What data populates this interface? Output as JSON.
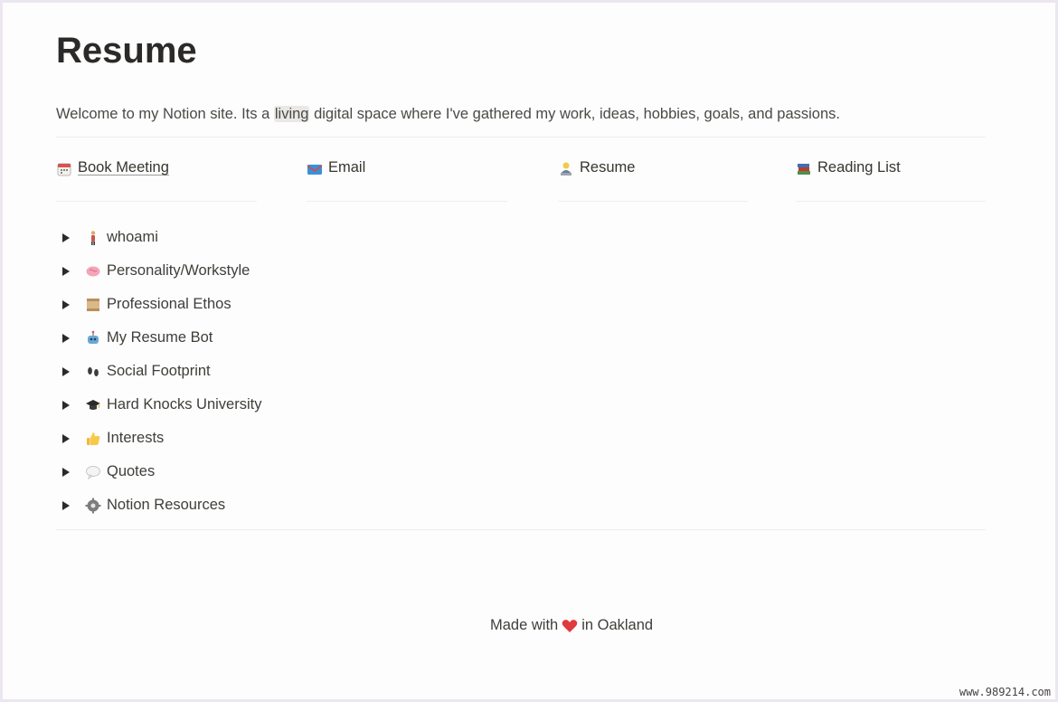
{
  "page": {
    "title": "Resume",
    "intro_before": "Welcome to my Notion site. Its a ",
    "intro_highlight": "living",
    "intro_after": " digital space where I've gathered my work, ideas, hobbies, goals, and passions."
  },
  "links": [
    {
      "label": "Book Meeting",
      "icon": "calendar-icon"
    },
    {
      "label": "Email",
      "icon": "envelope-icon"
    },
    {
      "label": "Resume",
      "icon": "person-at-laptop-icon"
    },
    {
      "label": "Reading List",
      "icon": "books-icon"
    }
  ],
  "toggles": [
    {
      "label": "whoami",
      "icon": "person-standing-icon"
    },
    {
      "label": "Personality/Workstyle",
      "icon": "brain-icon"
    },
    {
      "label": "Professional Ethos",
      "icon": "scroll-icon"
    },
    {
      "label": "My Resume Bot",
      "icon": "robot-icon"
    },
    {
      "label": "Social Footprint",
      "icon": "footprints-icon"
    },
    {
      "label": "Hard Knocks University",
      "icon": "graduation-cap-icon"
    },
    {
      "label": "Interests",
      "icon": "thumbs-up-icon"
    },
    {
      "label": "Quotes",
      "icon": "speech-bubble-icon"
    },
    {
      "label": "Notion Resources",
      "icon": "gear-icon"
    }
  ],
  "footer": {
    "before": "Made with",
    "after": "in Oakland"
  },
  "watermark": "www.989214.com",
  "colors": {
    "text": "#37352f",
    "heart": "#e0393e",
    "highlight": "#e9e8e6"
  }
}
